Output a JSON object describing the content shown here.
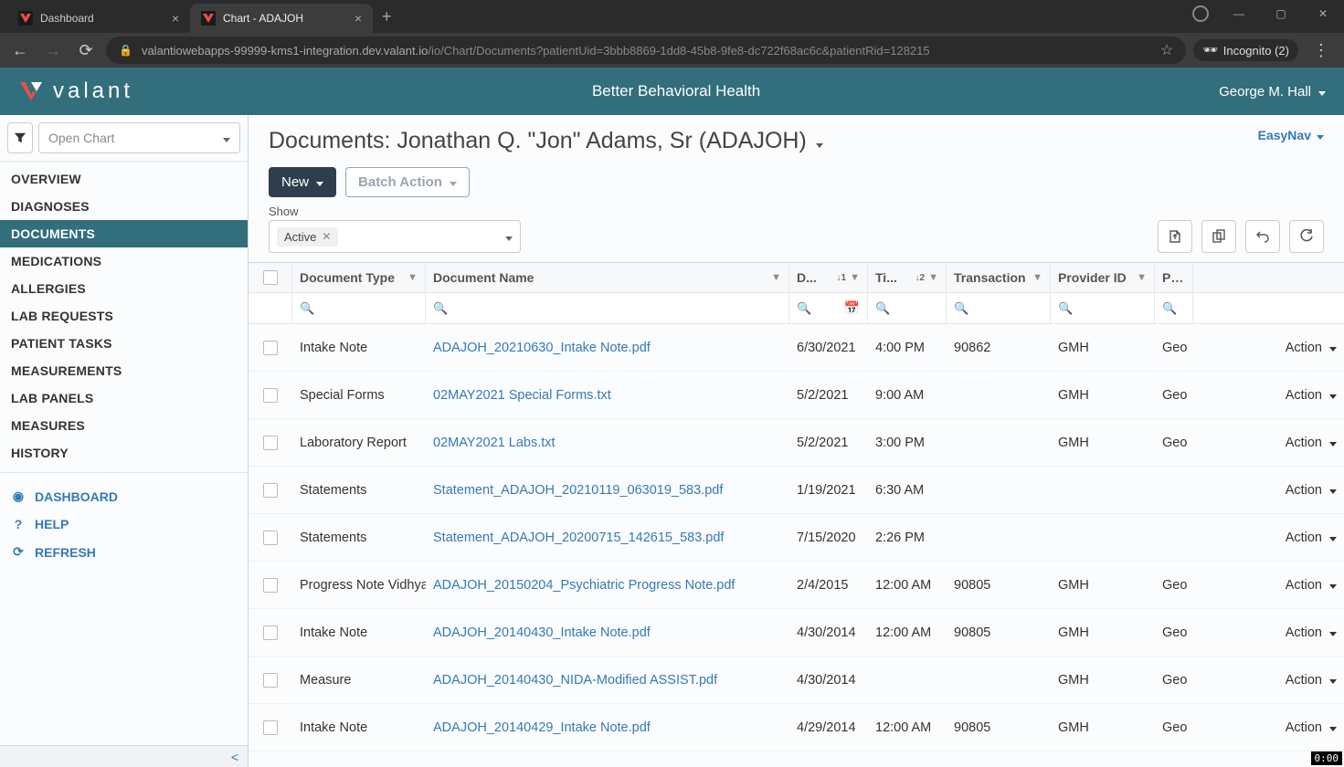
{
  "browser": {
    "tabs": [
      {
        "title": "Dashboard",
        "active": false
      },
      {
        "title": "Chart - ADAJOH",
        "active": true
      }
    ],
    "url_host": "valantiowebapps-99999-kms1-integration.dev.valant.io",
    "url_path": "/io/Chart/Documents?patientUid=3bbb8869-1dd8-45b8-9fe8-dc722f68ac6c&patientRid=128215",
    "incognito": "Incognito (2)"
  },
  "header": {
    "brand": "valant",
    "org": "Better Behavioral Health",
    "user": "George M. Hall"
  },
  "sidebar": {
    "open_chart_placeholder": "Open Chart",
    "items": [
      "OVERVIEW",
      "DIAGNOSES",
      "DOCUMENTS",
      "MEDICATIONS",
      "ALLERGIES",
      "LAB REQUESTS",
      "PATIENT TASKS",
      "MEASUREMENTS",
      "LAB PANELS",
      "MEASURES",
      "HISTORY"
    ],
    "active_index": 2,
    "footer": [
      {
        "icon": "dashboard",
        "label": "DASHBOARD"
      },
      {
        "icon": "help",
        "label": "HELP"
      },
      {
        "icon": "refresh",
        "label": "REFRESH"
      }
    ]
  },
  "page": {
    "title": "Documents: Jonathan Q. \"Jon\" Adams, Sr (ADAJOH)",
    "easynav": "EasyNav",
    "new_label": "New",
    "batch_label": "Batch Action",
    "show_label": "Show",
    "show_chip": "Active"
  },
  "columns": {
    "type": "Document Type",
    "name": "Document Name",
    "date": "D...",
    "time": "Ti...",
    "trans": "Transaction",
    "provid": "Provider ID",
    "prov": "Prov",
    "action": "Action",
    "sort1": "↓1",
    "sort2": "↓2"
  },
  "rows": [
    {
      "type": "Intake Note",
      "name": "ADAJOH_20210630_Intake Note.pdf",
      "date": "6/30/2021",
      "time": "4:00 PM",
      "trans": "90862",
      "provid": "GMH",
      "prov": "Geo"
    },
    {
      "type": "Special Forms",
      "name": "02MAY2021 Special Forms.txt",
      "date": "5/2/2021",
      "time": "9:00 AM",
      "trans": "",
      "provid": "GMH",
      "prov": "Geo"
    },
    {
      "type": "Laboratory Report",
      "name": "02MAY2021 Labs.txt",
      "date": "5/2/2021",
      "time": "3:00 PM",
      "trans": "",
      "provid": "GMH",
      "prov": "Geo"
    },
    {
      "type": "Statements",
      "name": "Statement_ADAJOH_20210119_063019_583.pdf",
      "date": "1/19/2021",
      "time": "6:30 AM",
      "trans": "",
      "provid": "",
      "prov": ""
    },
    {
      "type": "Statements",
      "name": "Statement_ADAJOH_20200715_142615_583.pdf",
      "date": "7/15/2020",
      "time": "2:26 PM",
      "trans": "",
      "provid": "",
      "prov": ""
    },
    {
      "type": "Progress Note Vidhya",
      "name": "ADAJOH_20150204_Psychiatric Progress Note.pdf",
      "date": "2/4/2015",
      "time": "12:00 AM",
      "trans": "90805",
      "provid": "GMH",
      "prov": "Geo"
    },
    {
      "type": "Intake Note",
      "name": "ADAJOH_20140430_Intake Note.pdf",
      "date": "4/30/2014",
      "time": "12:00 AM",
      "trans": "90805",
      "provid": "GMH",
      "prov": "Geo"
    },
    {
      "type": "Measure",
      "name": "ADAJOH_20140430_NIDA-Modified ASSIST.pdf",
      "date": "4/30/2014",
      "time": "",
      "trans": "",
      "provid": "GMH",
      "prov": "Geo"
    },
    {
      "type": "Intake Note",
      "name": "ADAJOH_20140429_Intake Note.pdf",
      "date": "4/29/2014",
      "time": "12:00 AM",
      "trans": "90805",
      "provid": "GMH",
      "prov": "Geo"
    }
  ],
  "video_time": "0:00"
}
